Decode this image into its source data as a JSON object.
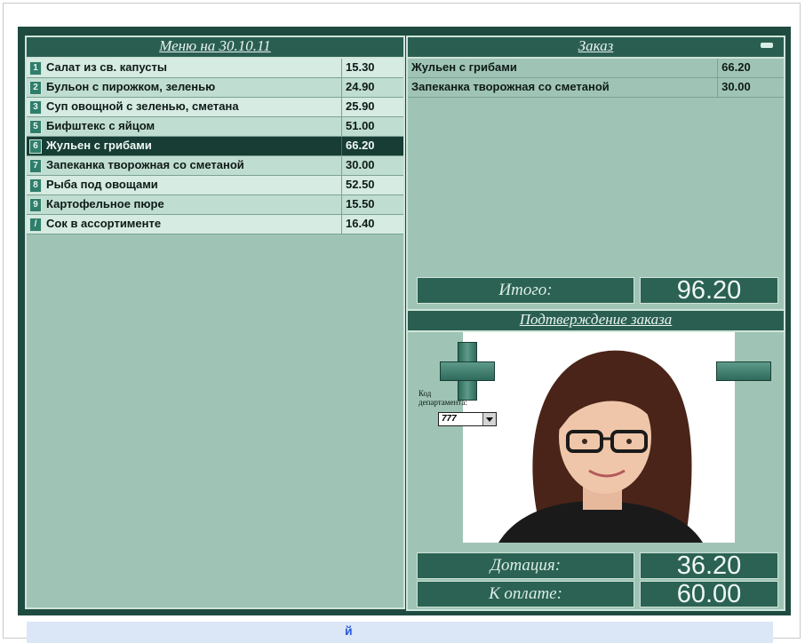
{
  "menu": {
    "title": "Меню на 30.10.11",
    "items": [
      {
        "num": "1",
        "name": "Салат из св. капусты",
        "price": "15.30"
      },
      {
        "num": "2",
        "name": "Бульон с пирожком, зеленью",
        "price": "24.90"
      },
      {
        "num": "3",
        "name": "Суп овощной с зеленью, сметана",
        "price": "25.90"
      },
      {
        "num": "5",
        "name": "Бифштекс с яйцом",
        "price": "51.00"
      },
      {
        "num": "6",
        "name": "Жульен с грибами",
        "price": "66.20",
        "selected": true
      },
      {
        "num": "7",
        "name": "Запеканка творожная со сметаной",
        "price": "30.00"
      },
      {
        "num": "8",
        "name": "Рыба под овощами",
        "price": "52.50"
      },
      {
        "num": "9",
        "name": "Картофельное пюре",
        "price": "15.50"
      },
      {
        "num": "/",
        "name": "Сок в ассортименте",
        "price": "16.40"
      }
    ]
  },
  "order": {
    "title": "Заказ",
    "items": [
      {
        "name": "Жульен с грибами",
        "price": "66.20"
      },
      {
        "name": "Запеканка творожная со сметаной",
        "price": "30.00"
      }
    ],
    "total_label": "Итого:",
    "total_value": "96.20"
  },
  "confirm": {
    "title": "Подтверждение заказа",
    "dept_label_line1": "Код",
    "dept_label_line2": "департамента:",
    "dept_value": "777",
    "subsidy_label": "Дотация:",
    "subsidy_value": "36.20",
    "to_pay_label": "К оплате:",
    "to_pay_value": "60.00"
  },
  "bottom_bar": {
    "glyph": "й"
  },
  "colors": {
    "frame": "#1e4a3f",
    "panel": "#9fc4b5",
    "selected_row": "#173d34",
    "accent_blue": "#2b59d9"
  },
  "icons": [
    "plus-icon",
    "minus-icon",
    "chevron-down-icon",
    "minimize-icon"
  ]
}
